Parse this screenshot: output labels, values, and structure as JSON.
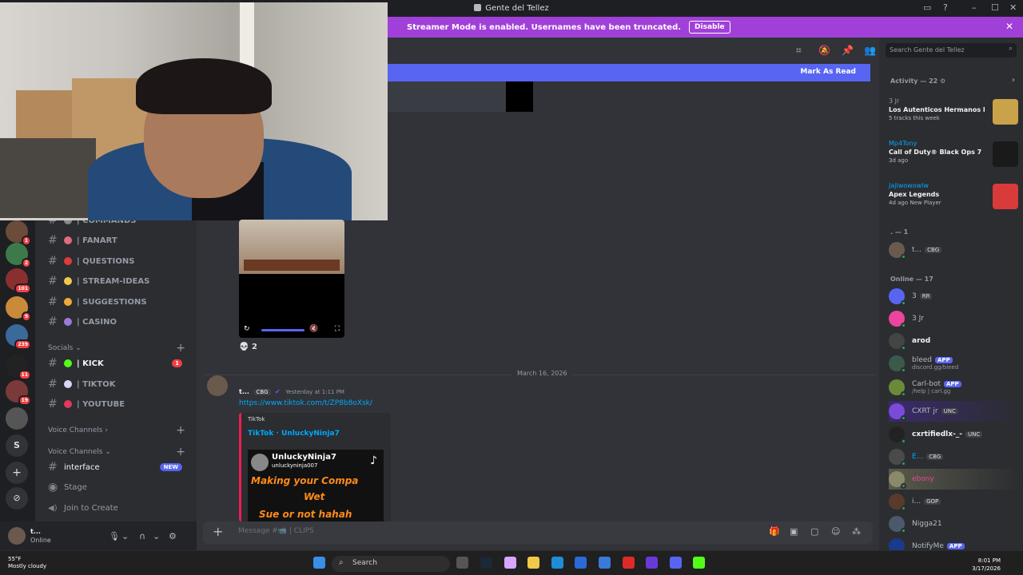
{
  "window": {
    "title": "Gente del Tellez",
    "minimize": "–",
    "maximize": "☐",
    "close": "✕"
  },
  "banner": {
    "text": "Streamer Mode is enabled. Usernames have been truncated.",
    "button": "Disable",
    "close": "✕"
  },
  "servers": [
    {
      "badge": "1",
      "color": "#6b4b3a"
    },
    {
      "badge": "2",
      "color": "#3d7a4a"
    },
    {
      "badge": "101",
      "color": "#8a2f2f"
    },
    {
      "badge": "9",
      "color": "#c98a3a"
    },
    {
      "badge": "239",
      "color": "#3a6a9a"
    },
    {
      "badge": "11",
      "color": "#222222"
    },
    {
      "badge": "19",
      "color": "#7a3a3a"
    },
    {
      "badge": "",
      "color": "#555555"
    }
  ],
  "server_letter": "S",
  "channels": {
    "items": [
      {
        "label": "| COMMANDS",
        "emoji_color": "#888888"
      },
      {
        "label": "| FANART",
        "emoji_color": "#e06b7a"
      },
      {
        "label": "| QUESTIONS",
        "emoji_color": "#e03a3a"
      },
      {
        "label": "| STREAM-IDEAS",
        "emoji_color": "#f2c84b"
      },
      {
        "label": "| SUGGESTIONS",
        "emoji_color": "#f2a93b"
      },
      {
        "label": "| CASINO",
        "emoji_color": "#9b7bd9"
      }
    ],
    "socials_label": "Socials",
    "socials": [
      {
        "label": "| KICK",
        "emoji_color": "#53fc18",
        "badge": "1"
      },
      {
        "label": "| TIKTOK",
        "emoji_color": "#dcd3f5",
        "badge": ""
      },
      {
        "label": "| YOUTUBE",
        "emoji_color": "#e03a5a",
        "badge": ""
      }
    ],
    "voice_label_1": "Voice Channels",
    "voice_label_2": "Voice Channels",
    "interface": {
      "label": "interface",
      "badge": "NEW"
    },
    "stage": "Stage",
    "join": "Join to Create"
  },
  "user_panel": {
    "name": "t...",
    "status": "Online"
  },
  "chat": {
    "mark_read": "Mark As Read",
    "reaction_count": "2",
    "date_divider": "March 16, 2026",
    "message": {
      "author": "t...",
      "tag": "CBG",
      "timestamp": "Yesterday at 1:11 PM",
      "link": "https://www.tiktok.com/t/ZP8b8oXsk/",
      "embed_provider": "TikTok",
      "embed_title": "TikTok · UnluckyNinja7",
      "card_username": "UnluckyNinja7",
      "card_handle": "unluckyninja007",
      "card_caption_1": "Making your Compa",
      "card_caption_2": "Wet",
      "card_caption_3": "Sue or not hahah"
    },
    "composer_placeholder": "Message #📹 | CLIPS"
  },
  "right_panel": {
    "search_placeholder": "Search Gente del Tellez",
    "activity_header": "Activity — 22",
    "activities": [
      {
        "who": "3 Jr",
        "game": "Los Autenticos Hermanos B...",
        "sub": "5 tracks this week",
        "art_color": "#c9a24a"
      },
      {
        "who": "Mp4Tony",
        "game": "Call of Duty® Black Ops 7",
        "sub": "3d ago",
        "art_color": "#1a1a1a"
      },
      {
        "who": "Jajlwowowlw",
        "game": "Apex Legends",
        "sub": "4d ago  New Player",
        "art_color": "#d93a3a"
      }
    ],
    "offline_section": ". — 1",
    "offline_member": {
      "name": "t...",
      "tag": "CBG"
    },
    "online_section": "Online — 17",
    "members": [
      {
        "name": "3",
        "extra": "RR",
        "app": "",
        "sub": "",
        "color": "#5865f2"
      },
      {
        "name": "3 Jr",
        "extra": "",
        "app": "",
        "sub": "",
        "color": "#eb459e"
      },
      {
        "name": "arod",
        "extra": "",
        "app": "",
        "sub": "",
        "color": "#444444"
      },
      {
        "name": "bleed",
        "extra": "",
        "app": "APP",
        "sub": "discord.gg/bleed",
        "color": "#3a5a4a"
      },
      {
        "name": "Carl-bot",
        "extra": "",
        "app": "APP",
        "sub": "/help | carl.gg",
        "color": "#6a8a3a"
      },
      {
        "name": "CXRT jr",
        "extra": "UNC",
        "app": "",
        "sub": "",
        "color": "#7a4ad9"
      },
      {
        "name": "cxrtifiedlx-_-",
        "extra": "UNC",
        "app": "",
        "sub": "",
        "color": "#222222"
      },
      {
        "name": "E...",
        "extra": "CBG",
        "app": "",
        "sub": "",
        "color": "#4a4a4a"
      },
      {
        "name": "ebony",
        "extra": "",
        "app": "",
        "sub": "",
        "color": "#8a8a6a"
      },
      {
        "name": "i...",
        "extra": "GOP",
        "app": "",
        "sub": "",
        "color": "#5a3a2a"
      },
      {
        "name": "Nigga21",
        "extra": "",
        "app": "",
        "sub": "",
        "color": "#4a5a6a"
      },
      {
        "name": "NotifyMe",
        "extra": "",
        "app": "APP",
        "sub": "",
        "color": "#1a3a8a"
      }
    ]
  },
  "taskbar": {
    "temp": "55°F",
    "weather": "Mostly cloudy",
    "search": "Search",
    "time": "8:01 PM",
    "date": "3/17/2026",
    "weather_badge": "3"
  }
}
